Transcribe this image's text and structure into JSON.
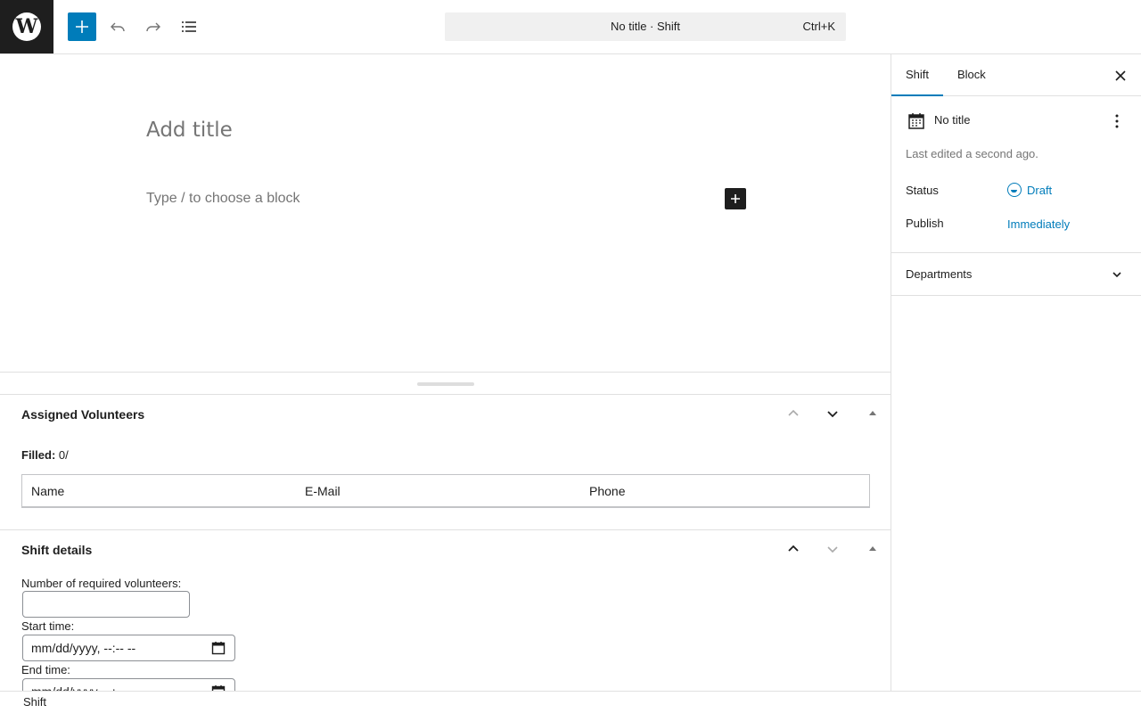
{
  "toolbar": {
    "logo_icon": "wordpress-logo-icon",
    "logo_letter": "W",
    "add_block_icon": "plus-icon",
    "undo_icon": "undo-icon",
    "redo_icon": "redo-icon",
    "list_view_icon": "list-view-icon",
    "accent": "#007cba"
  },
  "command_bar": {
    "title": "No title · Shift",
    "shortcut": "Ctrl+K"
  },
  "editor": {
    "title_placeholder": "Add title",
    "block_placeholder": "Type / to choose a block"
  },
  "assigned_volunteers": {
    "title": "Assigned Volunteers",
    "filled_label": "Filled:",
    "filled_value": "0/",
    "columns": [
      "Name",
      "E-Mail",
      "Phone"
    ]
  },
  "shift_details": {
    "title": "Shift details",
    "required_label": "Number of required volunteers:",
    "required_value": "",
    "start_label": "Start time:",
    "start_placeholder": "mm/dd/yyyy, --:-- --",
    "end_label": "End time:",
    "end_placeholder": "mm/dd/yyyy, --:-- --"
  },
  "sidebar": {
    "tabs": [
      "Shift",
      "Block"
    ],
    "active_tab": "Shift",
    "post_title": "No title",
    "last_edited": "Last edited a second ago.",
    "status_label": "Status",
    "status_value": "Draft",
    "publish_label": "Publish",
    "publish_value": "Immediately",
    "departments_label": "Departments"
  },
  "footer": {
    "breadcrumb": "Shift"
  }
}
